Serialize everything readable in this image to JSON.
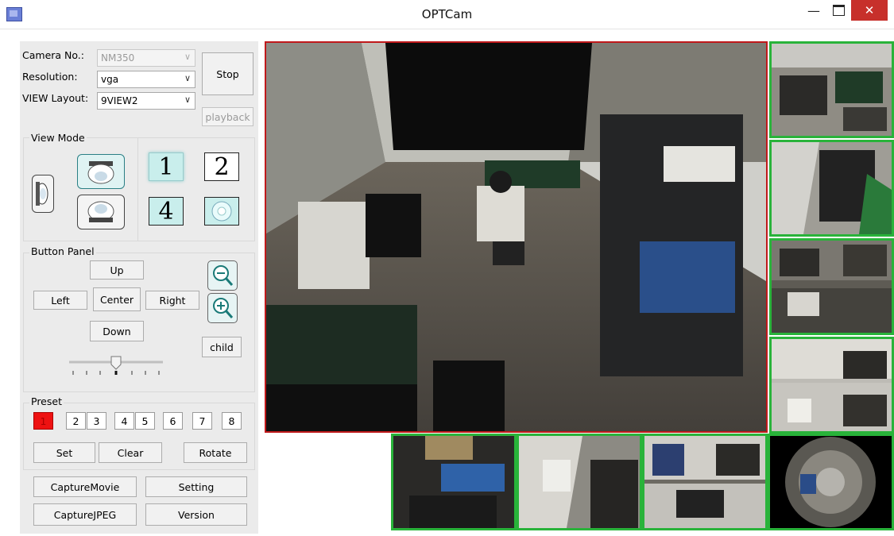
{
  "window": {
    "title": "OPTCam",
    "minimize": "—",
    "close": "✕"
  },
  "camera": {
    "label": "Camera No.:",
    "value": "NM350"
  },
  "resolution": {
    "label": "Resolution:",
    "value": "vga"
  },
  "layout": {
    "label": "VIEW Layout:",
    "value": "9VIEW2"
  },
  "buttons": {
    "stop": "Stop",
    "playback": "playback"
  },
  "view_mode": {
    "title": "View Mode",
    "tiles": [
      "1",
      "2",
      "4"
    ]
  },
  "button_panel": {
    "title": "Button Panel",
    "up": "Up",
    "left": "Left",
    "center": "Center",
    "right": "Right",
    "down": "Down",
    "child": "child",
    "slider_level": 0.5
  },
  "preset": {
    "title": "Preset",
    "numbers": [
      "1",
      "2",
      "3",
      "4",
      "5",
      "6",
      "7",
      "8"
    ],
    "active": "1",
    "set": "Set",
    "clear": "Clear",
    "rotate": "Rotate"
  },
  "bottom": {
    "capture_movie": "CaptureMovie",
    "setting": "Setting",
    "capture_jpeg": "CaptureJPEG",
    "version": "Version"
  },
  "colors": {
    "active_border": "#c0191b",
    "thumb_border": "#29b33a",
    "preset_active": "#ee1111",
    "close_button": "#c7302b"
  }
}
